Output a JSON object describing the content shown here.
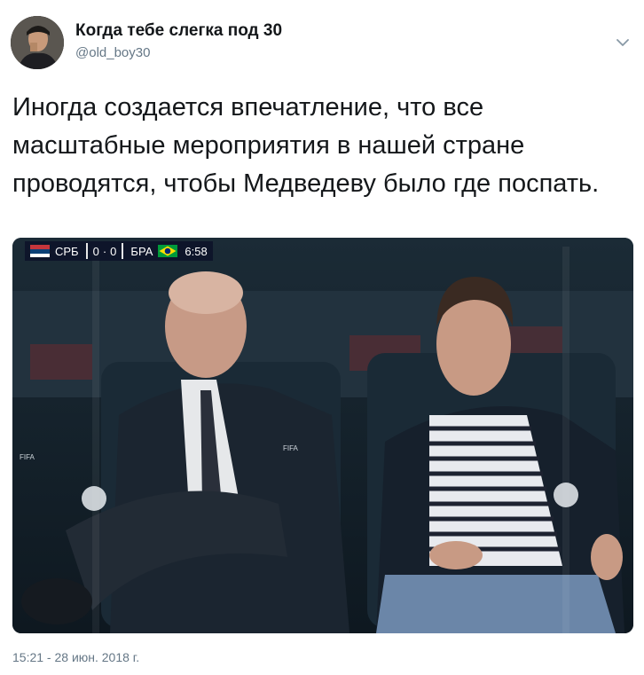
{
  "author": {
    "display_name": "Когда тебе слегка под 30",
    "handle": "@old_boy30",
    "avatar_icon": "user-avatar"
  },
  "menu_icon": "chevron-down-icon",
  "tweet": {
    "text": "Иногда создается впечатление, что все масштабные мероприятия в нашей стране проводятся, чтобы Медведеву было где поспать.",
    "timestamp": "15:21 - 28 июн. 2018 г."
  },
  "media": {
    "scorebug": {
      "home_team": "СРБ",
      "home_score": "0",
      "away_score": "0",
      "away_team": "БРА",
      "clock": "6:58"
    },
    "logo_text": "FIFA"
  },
  "colors": {
    "text": "#14171a",
    "secondary": "#657786"
  }
}
